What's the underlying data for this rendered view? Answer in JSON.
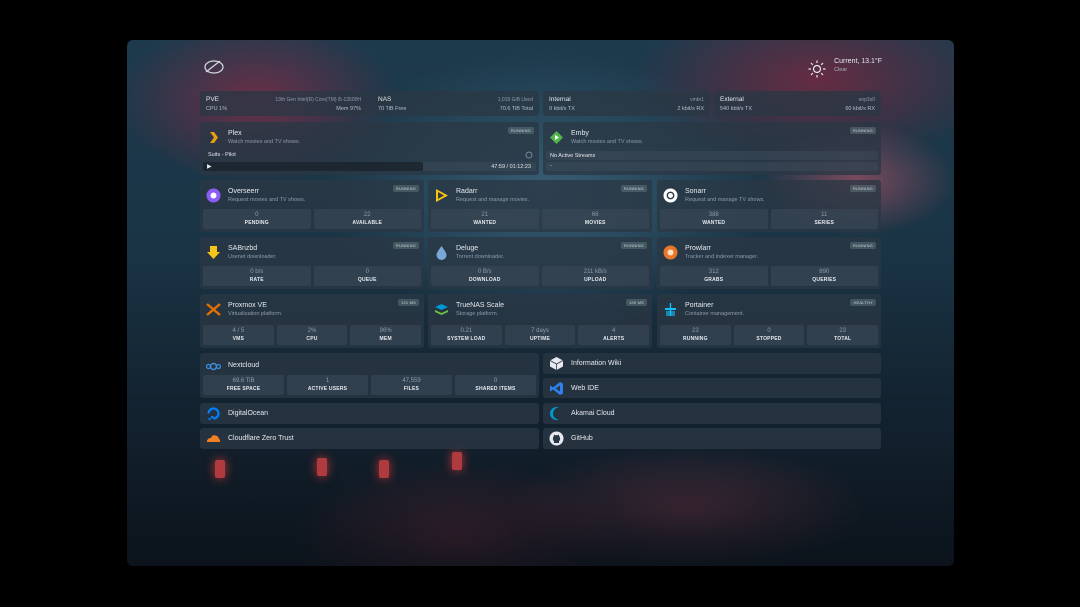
{
  "weather": {
    "title": "Current, 13.1°F",
    "condition": "Clear",
    "icon": "sun-icon"
  },
  "resources": [
    {
      "name": "PVE",
      "top_right": "13th Gen Intel(R) Core(TM) i5-13500H",
      "bottom_left": "CPU  1%",
      "bottom_right": "Mem  97%"
    },
    {
      "name": "NAS",
      "top_right": "1,018 GiB Used",
      "bottom_left": "70 TiB Free",
      "bottom_right": "70.6 TiB Total"
    },
    {
      "name": "Internal",
      "top_right": "vmbr1",
      "bottom_left": "9 kbit/s TX",
      "bottom_right": "2 kbit/s RX"
    },
    {
      "name": "External",
      "top_right": "enp3s0",
      "bottom_left": "540 kbit/s TX",
      "bottom_right": "60 kbit/s RX"
    }
  ],
  "plex": {
    "title": "Plex",
    "desc": "Watch movies and TV shows.",
    "badge": "RUNNING",
    "now_playing": "Suits - Pilot",
    "time": "47:59 / 01:12:23"
  },
  "emby": {
    "title": "Emby",
    "desc": "Watch movies and TV shows.",
    "badge": "RUNNING",
    "status": "No Active Streams",
    "dash": "-"
  },
  "services": [
    {
      "title": "Overseerr",
      "desc": "Request movies and TV shows.",
      "badge": "RUNNING",
      "stats": [
        {
          "v": "0",
          "l": "PENDING"
        },
        {
          "v": "22",
          "l": "AVAILABLE"
        }
      ]
    },
    {
      "title": "Radarr",
      "desc": "Request and manage movies.",
      "badge": "RUNNING",
      "stats": [
        {
          "v": "21",
          "l": "WANTED"
        },
        {
          "v": "66",
          "l": "MOVIES"
        }
      ]
    },
    {
      "title": "Sonarr",
      "desc": "Request and manage TV shows.",
      "badge": "RUNNING",
      "stats": [
        {
          "v": "388",
          "l": "WANTED"
        },
        {
          "v": "11",
          "l": "SERIES"
        }
      ]
    },
    {
      "title": "SABnzbd",
      "desc": "Usenet downloader.",
      "badge": "RUNNING",
      "stats": [
        {
          "v": "0 b/s",
          "l": "RATE"
        },
        {
          "v": "0",
          "l": "QUEUE"
        }
      ]
    },
    {
      "title": "Deluge",
      "desc": "Torrent downloader.",
      "badge": "RUNNING",
      "stats": [
        {
          "v": "0 B/s",
          "l": "DOWNLOAD"
        },
        {
          "v": "211 kB/s",
          "l": "UPLOAD"
        }
      ]
    },
    {
      "title": "Prowlarr",
      "desc": "Tracker and indexer manager.",
      "badge": "RUNNING",
      "stats": [
        {
          "v": "312",
          "l": "GRABS"
        },
        {
          "v": "890",
          "l": "QUERIES"
        }
      ]
    },
    {
      "title": "Proxmox VE",
      "desc": "Virtualization platform.",
      "badge": "131 MS",
      "stats": [
        {
          "v": "4 / 5",
          "l": "VMS"
        },
        {
          "v": "2%",
          "l": "CPU"
        },
        {
          "v": "96%",
          "l": "MEM"
        }
      ]
    },
    {
      "title": "TrueNAS Scale",
      "desc": "Storage platform.",
      "badge": "190 MS",
      "stats": [
        {
          "v": "0.21",
          "l": "SYSTEM LOAD"
        },
        {
          "v": "7 days",
          "l": "UPTIME"
        },
        {
          "v": "4",
          "l": "ALERTS"
        }
      ]
    },
    {
      "title": "Portainer",
      "desc": "Container management.",
      "badge": "HEALTHY",
      "stats": [
        {
          "v": "23",
          "l": "RUNNING"
        },
        {
          "v": "0",
          "l": "STOPPED"
        },
        {
          "v": "23",
          "l": "TOTAL"
        }
      ]
    }
  ],
  "nextcloud": {
    "title": "Nextcloud",
    "stats": [
      {
        "v": "69.6 TiB",
        "l": "FREE SPACE"
      },
      {
        "v": "1",
        "l": "ACTIVE USERS"
      },
      {
        "v": "47,559",
        "l": "FILES"
      },
      {
        "v": "0",
        "l": "SHARED ITEMS"
      }
    ]
  },
  "bookmarks": [
    "Information Wiki",
    "Web IDE",
    "DigitalOcean",
    "Akamai Cloud",
    "Cloudflare Zero Trust",
    "GitHub"
  ],
  "colors": {
    "card": "#2a3744",
    "accent_radarr": "#f5c518",
    "accent_sonarr": "#ffffff",
    "accent_prowlarr": "#e8762b",
    "accent_proxmox": "#e57000"
  }
}
